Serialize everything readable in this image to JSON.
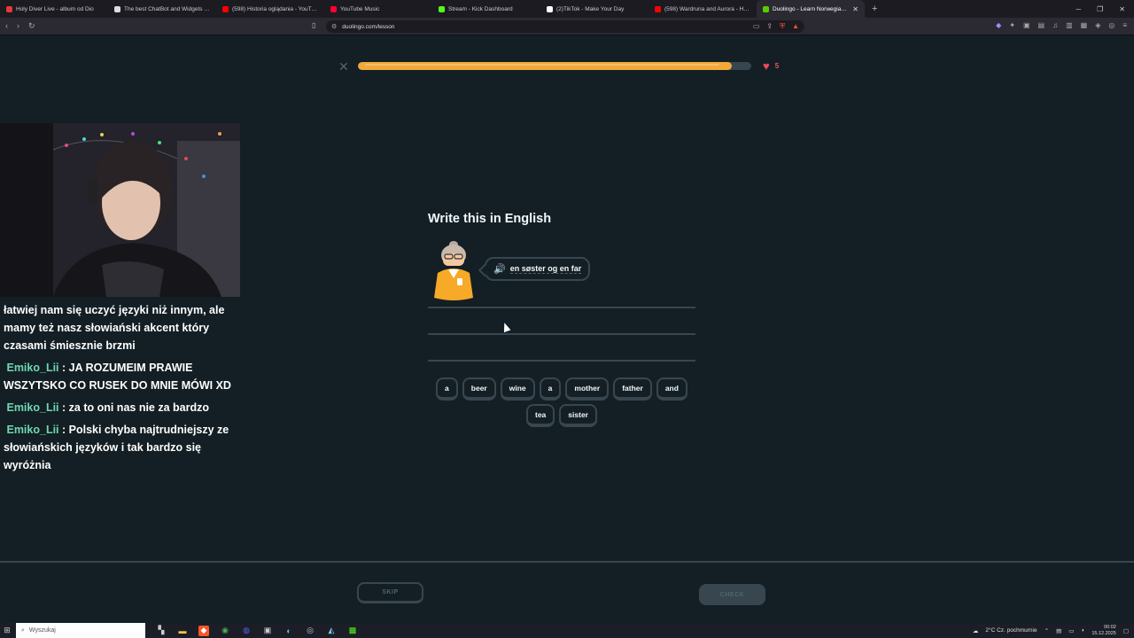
{
  "tabs": [
    {
      "title": "Holy Diver Live - album od Dio",
      "color": "#e53935",
      "active": false
    },
    {
      "title": "The best ChatBot and Widgets for Ki",
      "color": "#dddddd",
      "active": false
    },
    {
      "title": "(598) Historia oglądania - YouTube",
      "color": "#ff0000",
      "active": false
    },
    {
      "title": "YouTube Music",
      "color": "#ff0033",
      "active": false
    },
    {
      "title": "Stream - Kick Dashboard",
      "color": "#53fc18",
      "active": false
    },
    {
      "title": "(2)TikTok - Make Your Day",
      "color": "#ffffff",
      "active": false
    },
    {
      "title": "(598) Wardruna and Aurora - Helvegen",
      "color": "#ff0000",
      "active": false
    },
    {
      "title": "Duolingo - Learn Norwegian (Bok",
      "color": "#58cc02",
      "active": true
    }
  ],
  "browser": {
    "url": "duolingo.com/lesson",
    "newtab": "+"
  },
  "lesson": {
    "progress": 0.95,
    "hearts": "5",
    "prompt": "Write this in English",
    "sentence": "en søster og en far",
    "word_bank_row1": [
      "a",
      "beer",
      "wine",
      "a",
      "mother",
      "father",
      "and"
    ],
    "word_bank_row2": [
      "tea",
      "sister"
    ],
    "skip_label": "SKIP",
    "check_label": "CHECK"
  },
  "chat": {
    "messages": [
      {
        "user": "",
        "text": "łatwiej nam się uczyć języki niż innym, ale mamy też nasz słowiański akcent który czasami śmiesznie brzmi"
      },
      {
        "user": "Emiko_Lii",
        "text": " : JA ROZUMEIM PRAWIE WSZYTSKO CO RUSEK DO MNIE MÓWI XD"
      },
      {
        "user": "Emiko_Lii",
        "text": " : za to oni nas nie za bardzo"
      },
      {
        "user": "Emiko_Lii",
        "text": " : Polski chyba najtrudniejszy ze słowiańskich języków i tak bardzo się wyróżnia"
      }
    ]
  },
  "taskbar": {
    "search_placeholder": "Wyszukaj",
    "weather": "2°C  Cz. pochmurnie",
    "time": "00:02",
    "date": "15.12.2025"
  },
  "colors": {
    "background": "#131f24",
    "progress_fill": "#f2a83a",
    "border": "#37464f",
    "heart": "#ee4a5d",
    "chat_user": "#6fd7b4"
  }
}
